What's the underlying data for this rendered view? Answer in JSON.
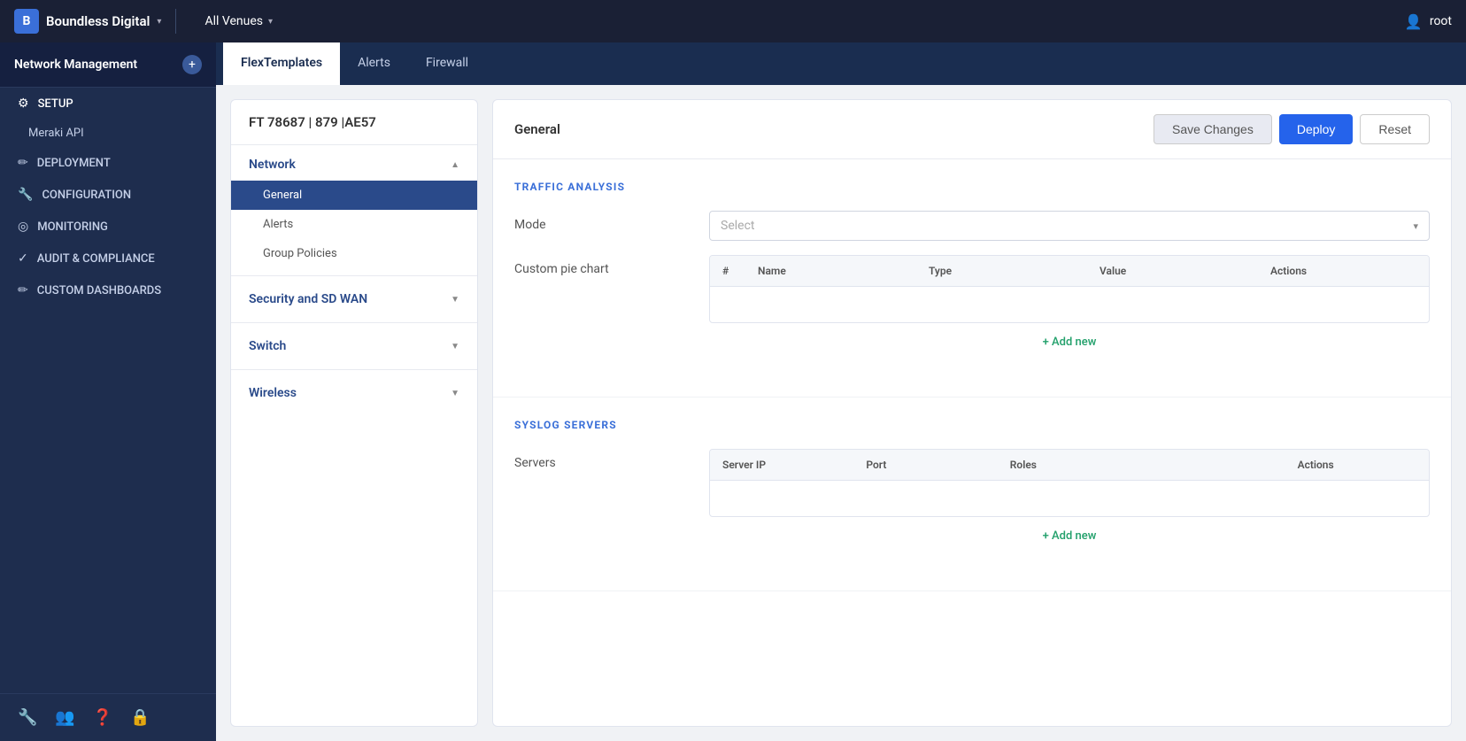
{
  "topBar": {
    "appTitle": "Network Management",
    "addIcon": "+",
    "orgName": "Boundless Digital",
    "venueName": "All Venues",
    "userName": "root"
  },
  "tabs": [
    {
      "id": "flextemplates",
      "label": "FlexTemplates",
      "active": true
    },
    {
      "id": "alerts",
      "label": "Alerts",
      "active": false
    },
    {
      "id": "firewall",
      "label": "Firewall",
      "active": false
    }
  ],
  "sidebar": {
    "sections": [
      {
        "title": "SETUP",
        "items": [
          {
            "label": "SETUP",
            "icon": "⚙",
            "isHeader": true
          },
          {
            "label": "Meraki API",
            "icon": "",
            "isSub": true
          }
        ]
      },
      {
        "title": "DEPLOYMENT",
        "items": [
          {
            "label": "DEPLOYMENT",
            "icon": "✏",
            "isHeader": true
          }
        ]
      },
      {
        "title": "CONFIGURATION",
        "items": [
          {
            "label": "CONFIGURATION",
            "icon": "🔧",
            "isHeader": true
          }
        ]
      },
      {
        "title": "MONITORING",
        "items": [
          {
            "label": "MONITORING",
            "icon": "◎",
            "isHeader": true
          }
        ]
      },
      {
        "title": "AUDIT & COMPLIANCE",
        "items": [
          {
            "label": "AUDIT & COMPLIANCE",
            "icon": "✓",
            "isHeader": true
          }
        ]
      },
      {
        "title": "CUSTOM DASHBOARDS",
        "items": [
          {
            "label": "CUSTOM DASHBOARDS",
            "icon": "✏",
            "isHeader": true
          }
        ]
      }
    ],
    "footerIcons": [
      "🔧",
      "👥",
      "❓",
      "🔒"
    ]
  },
  "leftPanel": {
    "header": "FT 78687 | 879 |AE57",
    "tree": [
      {
        "label": "Network",
        "expanded": true,
        "children": [
          {
            "label": "General",
            "selected": true
          },
          {
            "label": "Alerts",
            "selected": false
          },
          {
            "label": "Group Policies",
            "selected": false
          }
        ]
      },
      {
        "label": "Security and SD WAN",
        "expanded": false,
        "children": []
      },
      {
        "label": "Switch",
        "expanded": false,
        "children": []
      },
      {
        "label": "Wireless",
        "expanded": false,
        "children": []
      }
    ]
  },
  "rightPanel": {
    "title": "General",
    "actions": {
      "saveChanges": "Save Changes",
      "deploy": "Deploy",
      "reset": "Reset"
    },
    "trafficAnalysis": {
      "sectionTitle": "TRAFFIC ANALYSIS",
      "modeLabel": "Mode",
      "selectPlaceholder": "Select",
      "customPieChartLabel": "Custom pie chart",
      "tableHeaders": [
        "#",
        "Name",
        "Type",
        "Value",
        "Actions"
      ],
      "addNewLabel": "+ Add new"
    },
    "syslogServers": {
      "sectionTitle": "SYSLOG SERVERS",
      "serversLabel": "Servers",
      "tableHeaders": [
        "Server IP",
        "Port",
        "Roles",
        "Actions"
      ],
      "addNewLabel": "+ Add new"
    }
  }
}
